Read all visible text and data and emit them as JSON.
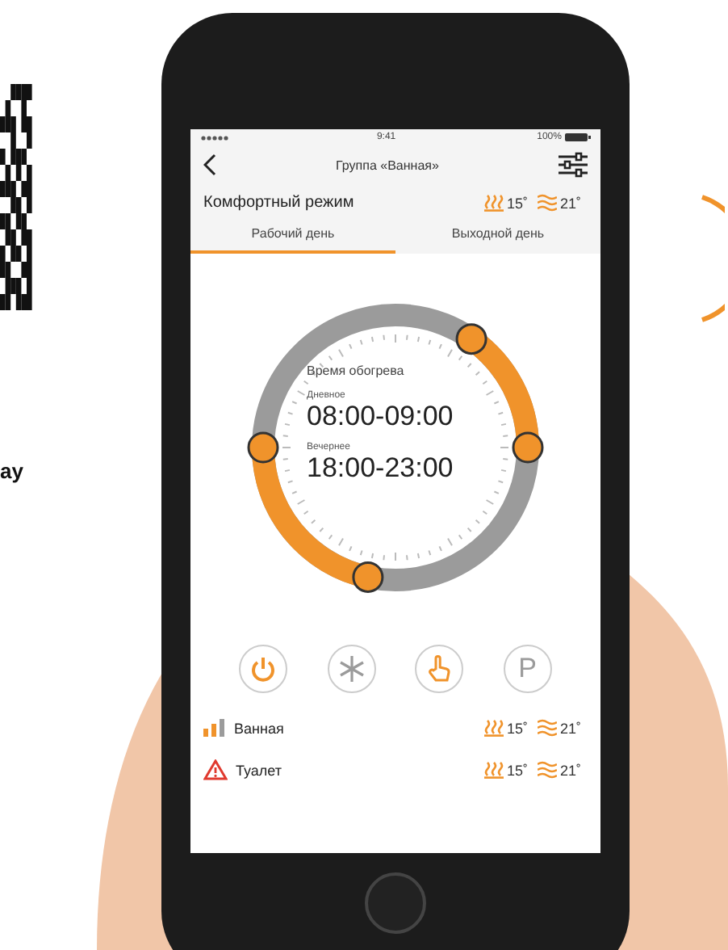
{
  "side_text": "ay",
  "status_bar": {
    "time": "9:41",
    "battery": "100%"
  },
  "header": {
    "title": "Группа «Ванная»"
  },
  "mode": {
    "label": "Комфортный режим",
    "floor_temp": "15˚",
    "air_temp": "21˚"
  },
  "tabs": [
    {
      "label": "Рабочий день",
      "selected": true
    },
    {
      "label": "Выходной день",
      "selected": false
    }
  ],
  "clock": {
    "title": "Время обогрева",
    "periods": [
      {
        "label": "Дневное",
        "time": "08:00-09:00"
      },
      {
        "label": "Вечернее",
        "time": "18:00-23:00"
      }
    ]
  },
  "mode_buttons": [
    {
      "kind": "power",
      "on": true
    },
    {
      "kind": "frost",
      "on": false
    },
    {
      "kind": "manual",
      "on": true
    },
    {
      "kind": "text",
      "label": "P",
      "on": false
    }
  ],
  "zones": [
    {
      "kind": "signal",
      "name": "Ванная",
      "floor_temp": "15˚",
      "air_temp": "21˚"
    },
    {
      "kind": "warning",
      "name": "Туалет",
      "floor_temp": "15˚",
      "air_temp": "21˚"
    }
  ]
}
